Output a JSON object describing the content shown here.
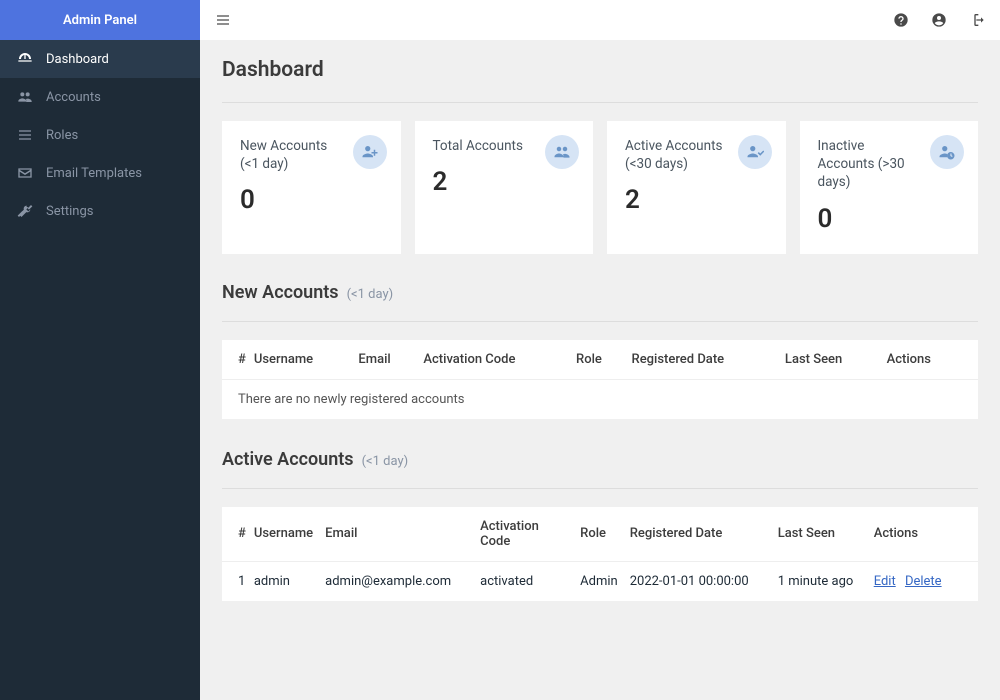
{
  "brand": "Admin Panel",
  "sidebar": {
    "items": [
      {
        "label": "Dashboard"
      },
      {
        "label": "Accounts"
      },
      {
        "label": "Roles"
      },
      {
        "label": "Email Templates"
      },
      {
        "label": "Settings"
      }
    ]
  },
  "page": {
    "title": "Dashboard"
  },
  "cards": [
    {
      "label": "New Accounts (<1 day)",
      "value": "0"
    },
    {
      "label": "Total Accounts",
      "value": "2"
    },
    {
      "label": "Active Accounts (<30 days)",
      "value": "2"
    },
    {
      "label": "Inactive Accounts (>30 days)",
      "value": "0"
    }
  ],
  "new_accounts": {
    "title": "New Accounts",
    "subtitle": "(<1 day)",
    "columns": [
      "#",
      "Username",
      "Email",
      "Activation Code",
      "Role",
      "Registered Date",
      "Last Seen",
      "Actions"
    ],
    "empty_message": "There are no newly registered accounts"
  },
  "active_accounts": {
    "title": "Active Accounts",
    "subtitle": "(<1 day)",
    "columns": [
      "#",
      "Username",
      "Email",
      "Activation Code",
      "Role",
      "Registered Date",
      "Last Seen",
      "Actions"
    ],
    "rows": [
      {
        "num": "1",
        "username": "admin",
        "email": "admin@example.com",
        "activation_code": "activated",
        "role": "Admin",
        "registered_date": "2022-01-01 00:00:00",
        "last_seen": "1 minute ago",
        "edit": "Edit",
        "delete": "Delete"
      }
    ]
  }
}
